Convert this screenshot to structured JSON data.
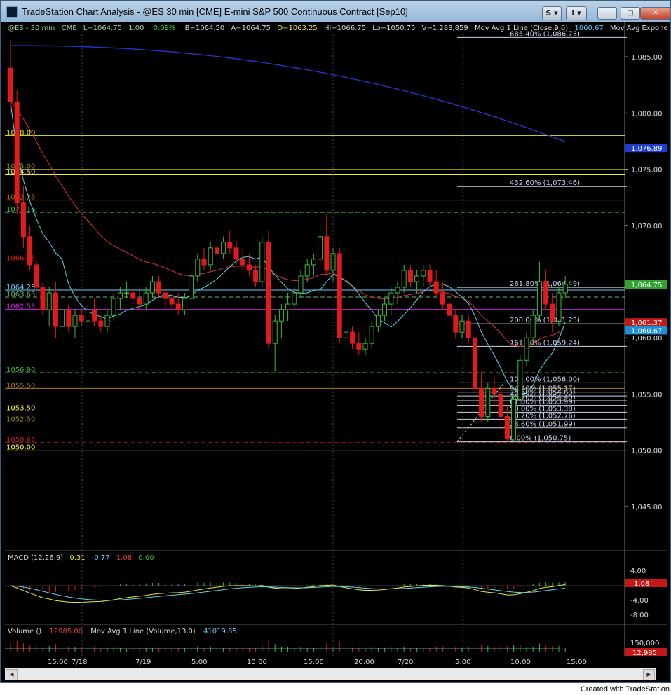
{
  "window": {
    "title": "TradeStation Chart Analysis - @ES 30 min [CME] E-mini S&P 500 Continuous Contract [Sep10]",
    "toolbar_s": "S",
    "toolbar_i": "I",
    "minimize": "—",
    "maximize": "□",
    "close": "✕"
  },
  "header": {
    "symbol": "@ES - 30 min",
    "exchange": "CME",
    "last": "L=1064.75",
    "change": "1.00",
    "pct": "0.09%",
    "bid": "B=1064.50",
    "ask": "A=1064.75",
    "open": "O=1063.25",
    "high": "Hi=1066.75",
    "low": "Lo=1050.75",
    "volume": "V=1,288,859",
    "ma1_label": "Mov Avg 1 Line (Close,9,0)",
    "ma1_value": "1060.67",
    "ma2_label": "Mov Avg Exponen ..."
  },
  "price_axis": {
    "ticks": [
      "1,085.00",
      "1,080.00",
      "1,075.00",
      "1,070.00",
      "1,065.00",
      "1,060.00",
      "1,055.00",
      "1,050.00",
      "1,045.00"
    ],
    "badges": [
      {
        "text": "1,076.89",
        "color": "#1f3dd1"
      },
      {
        "text": "1,064.75",
        "color": "#2fa32f"
      },
      {
        "text": "1,061.37",
        "color": "#c41818"
      },
      {
        "text": "1,060.67",
        "color": "#1d8fd6"
      }
    ]
  },
  "levels": [
    {
      "label": "1078.00",
      "color": "#e8e830",
      "style": "solid"
    },
    {
      "label": "1075.00",
      "color": "#8d8d1a",
      "style": "solid"
    },
    {
      "label": "1074.50",
      "color": "#f0f030",
      "style": "solid"
    },
    {
      "label": "1072.25",
      "color": "#b07d1e",
      "style": "solid"
    },
    {
      "label": "1071.16",
      "color": "#3cbb3c",
      "style": "dash"
    },
    {
      "label": "1066.83",
      "color": "#d02020",
      "style": "dash"
    },
    {
      "label": "1064.25",
      "color": "#6ad0ff",
      "style": "solid"
    },
    {
      "label": "1063.63",
      "color": "#6ab86a",
      "style": "dash"
    },
    {
      "label": "1062.53",
      "color": "#c02ad0",
      "style": "solid"
    },
    {
      "label": "1056.90",
      "color": "#3cbb3c",
      "style": "dash"
    },
    {
      "label": "1055.50",
      "color": "#b07d1e",
      "style": "solid"
    },
    {
      "label": "1053.50",
      "color": "#ffff40",
      "style": "solid"
    },
    {
      "label": "1052.50",
      "color": "#8d8d1a",
      "style": "solid"
    },
    {
      "label": "1050.67",
      "color": "#d02020",
      "style": "dash"
    },
    {
      "label": "1050.00",
      "color": "#ffff40",
      "style": "solid"
    }
  ],
  "fib": [
    "685.40% (1,086.73)",
    "432.60% (1,073.46)",
    "261.80% (1,064.49)",
    "200.00% (1,061.25)",
    "161.80% (1,059.24)",
    "100.00% (1,056.00)",
    "94.40% (1,055.17)",
    "78.60% (1,054.83)",
    "70.70% (1,054.40)",
    "61.80% (1,053.99)",
    "50.00% (1,053.38)",
    "38.20% (1,052.76)",
    "23.60% (1,051.99)",
    "0.00% (1,050.75)"
  ],
  "macd": {
    "label": "MACD (12,26,9)",
    "v1": "0.31",
    "v2": "-0.77",
    "v3": "1.08",
    "v4": "0.00",
    "ticks": [
      "4.00",
      "-4.00",
      "-8.00"
    ],
    "badge": "1.08"
  },
  "volume": {
    "label": "Volume ()",
    "value": "12985.00",
    "ma_label": "Mov Avg 1 Line (Volume,13,0)",
    "ma_value": "41019.85",
    "tick": "150,000",
    "badge": "12,985"
  },
  "time_axis": [
    "15:00",
    "7/18",
    "7/19",
    "5:00",
    "10:00",
    "15:00",
    "20:00",
    "7/20",
    "5:00",
    "10:00",
    "15:00"
  ],
  "footer": "Created with TradeStation",
  "chart_data": {
    "type": "candlestick",
    "symbol": "@ES",
    "interval": "30 min",
    "ylim": [
      1042.0,
      1087.0
    ],
    "ohlc": [
      [
        1084,
        1086.5,
        1080,
        1081
      ],
      [
        1081,
        1082,
        1071,
        1072
      ],
      [
        1072,
        1073.5,
        1068,
        1069
      ],
      [
        1069,
        1070,
        1066,
        1066.5
      ],
      [
        1066.5,
        1067,
        1063.5,
        1064.5
      ],
      [
        1064.5,
        1065,
        1062,
        1062.5
      ],
      [
        1062.5,
        1064.5,
        1061,
        1064
      ],
      [
        1064,
        1065,
        1060,
        1061
      ],
      [
        1061,
        1063,
        1059.5,
        1062.5
      ],
      [
        1062.5,
        1063,
        1060.5,
        1061
      ],
      [
        1061,
        1062.5,
        1060,
        1062
      ],
      [
        1062,
        1062.5,
        1061,
        1061.5
      ],
      [
        1061.5,
        1063,
        1061,
        1062.5
      ],
      [
        1062.5,
        1063.5,
        1061,
        1061.5
      ],
      [
        1061.5,
        1062,
        1060.5,
        1061
      ],
      [
        1061,
        1062.5,
        1060.5,
        1062
      ],
      [
        1062,
        1064,
        1061.5,
        1063.5
      ],
      [
        1063.5,
        1064.5,
        1062.5,
        1064
      ],
      [
        1064,
        1065,
        1063.5,
        1064
      ],
      [
        1064,
        1064.5,
        1063,
        1063.5
      ],
      [
        1063.5,
        1064.5,
        1062.5,
        1063
      ],
      [
        1063,
        1064.5,
        1062.5,
        1064
      ],
      [
        1064,
        1065.5,
        1063.5,
        1065
      ],
      [
        1065,
        1065.5,
        1063.5,
        1064
      ],
      [
        1064,
        1064.5,
        1062.5,
        1063.5
      ],
      [
        1063.5,
        1064,
        1062.5,
        1063
      ],
      [
        1063,
        1064,
        1062,
        1062.5
      ],
      [
        1062.5,
        1064,
        1062,
        1063.5
      ],
      [
        1063.5,
        1066,
        1063,
        1065.5
      ],
      [
        1065.5,
        1067.5,
        1065,
        1067
      ],
      [
        1067,
        1068,
        1066,
        1066.5
      ],
      [
        1066.5,
        1068.5,
        1066,
        1068
      ],
      [
        1068,
        1069,
        1067,
        1067.5
      ],
      [
        1067.5,
        1069,
        1067,
        1068.5
      ],
      [
        1068.5,
        1069.5,
        1067.5,
        1068
      ],
      [
        1068,
        1068.5,
        1066.5,
        1067
      ],
      [
        1067,
        1068,
        1066,
        1066.5
      ],
      [
        1066.5,
        1067.5,
        1065.5,
        1066
      ],
      [
        1066,
        1066.5,
        1064.5,
        1065
      ],
      [
        1065,
        1069,
        1064.5,
        1068.5
      ],
      [
        1068.5,
        1069.5,
        1059,
        1059.5
      ],
      [
        1059.5,
        1062,
        1057,
        1061.5
      ],
      [
        1061.5,
        1063,
        1060,
        1062.5
      ],
      [
        1062.5,
        1064,
        1061.5,
        1063
      ],
      [
        1063,
        1064.5,
        1062.5,
        1064
      ],
      [
        1064,
        1066,
        1063.5,
        1065.5
      ],
      [
        1065.5,
        1067,
        1065,
        1066.5
      ],
      [
        1066.5,
        1067.5,
        1065.5,
        1067
      ],
      [
        1067,
        1070,
        1066.5,
        1069
      ],
      [
        1069,
        1071,
        1065.5,
        1066
      ],
      [
        1066,
        1068,
        1065,
        1067.5
      ],
      [
        1067.5,
        1068,
        1059.5,
        1060
      ],
      [
        1060,
        1061.5,
        1059,
        1060.5
      ],
      [
        1060.5,
        1061,
        1059,
        1059.5
      ],
      [
        1059.5,
        1060.5,
        1058.5,
        1059
      ],
      [
        1059,
        1060,
        1058.5,
        1059.5
      ],
      [
        1059.5,
        1061.5,
        1059,
        1061
      ],
      [
        1061,
        1062.5,
        1060.5,
        1062
      ],
      [
        1062,
        1063.5,
        1061.5,
        1063
      ],
      [
        1063,
        1064.5,
        1062,
        1064
      ],
      [
        1064,
        1065,
        1063,
        1064.5
      ],
      [
        1064.5,
        1066.5,
        1064,
        1066
      ],
      [
        1066,
        1066.5,
        1064.5,
        1065
      ],
      [
        1065,
        1066,
        1064,
        1065.5
      ],
      [
        1065.5,
        1066.5,
        1064.5,
        1066
      ],
      [
        1066,
        1066.5,
        1064.5,
        1065
      ],
      [
        1065,
        1066,
        1063.5,
        1064
      ],
      [
        1064,
        1065,
        1062.5,
        1063
      ],
      [
        1063,
        1064,
        1061.5,
        1062
      ],
      [
        1062,
        1062.5,
        1060,
        1060.5
      ],
      [
        1060.5,
        1062,
        1060,
        1061.5
      ],
      [
        1061.5,
        1062,
        1059.5,
        1060
      ],
      [
        1060,
        1060.5,
        1055,
        1055.5
      ],
      [
        1055.5,
        1057,
        1052.5,
        1053
      ],
      [
        1053,
        1056,
        1052.5,
        1055.5
      ],
      [
        1055.5,
        1056.5,
        1054,
        1055
      ],
      [
        1055,
        1055.5,
        1052,
        1053
      ],
      [
        1053,
        1054,
        1050.75,
        1051
      ],
      [
        1051,
        1055,
        1050.75,
        1054.5
      ],
      [
        1054.5,
        1058.5,
        1054,
        1058
      ],
      [
        1058,
        1060.5,
        1057.5,
        1060
      ],
      [
        1060,
        1062.5,
        1059.5,
        1062
      ],
      [
        1062,
        1066.75,
        1061.5,
        1065
      ],
      [
        1065,
        1066,
        1062.5,
        1063
      ],
      [
        1063,
        1064,
        1060.5,
        1061.5
      ],
      [
        1061.5,
        1064.5,
        1061,
        1064
      ],
      [
        1064,
        1065.5,
        1063.5,
        1064.75
      ]
    ],
    "time_labels": [
      "15:00",
      "7/18",
      "7/19",
      "5:00",
      "10:00",
      "15:00",
      "20:00",
      "7/20",
      "5:00",
      "10:00",
      "15:00"
    ]
  }
}
